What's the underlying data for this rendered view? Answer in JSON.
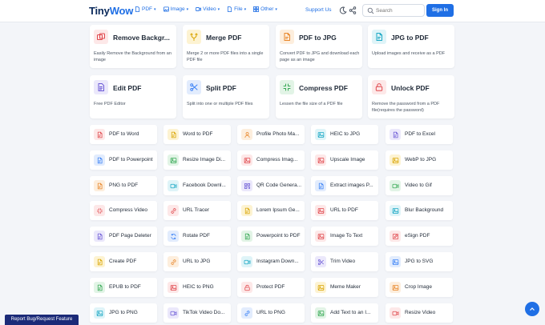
{
  "header": {
    "logo_a": "Tiny",
    "logo_b": "Wow",
    "nav": [
      {
        "label": "PDF",
        "icon": "pdf-icon"
      },
      {
        "label": "Image",
        "icon": "image-icon"
      },
      {
        "label": "Video",
        "icon": "video-icon"
      },
      {
        "label": "File",
        "icon": "file-icon"
      },
      {
        "label": "Other",
        "icon": "grid-icon"
      }
    ],
    "support": "Support Us",
    "search_placeholder": "Search",
    "signin": "Sign In"
  },
  "colors": {
    "brand": "#1f6fe5",
    "navy": "#0b2a5b",
    "report_bg": "#1b2a78"
  },
  "featured": [
    {
      "title": "Remove Backgr...",
      "desc": "Easily Remove the Background from an image",
      "icon": "remove-bg-icon",
      "color": "#e0474c",
      "bg": "#fde8e8"
    },
    {
      "title": "Merge PDF",
      "desc": "Merge 2 or more PDF files into a single PDF file",
      "icon": "merge-icon",
      "color": "#d9a400",
      "bg": "#fdf3d2"
    },
    {
      "title": "PDF to JPG",
      "desc": "Convert PDF to JPG and download each page as an image",
      "icon": "document-icon",
      "color": "#e8862a",
      "bg": "#fdeedd"
    },
    {
      "title": "JPG to PDF",
      "desc": "Upload images and receive as a PDF",
      "icon": "document-icon",
      "color": "#19a7c4",
      "bg": "#dff4f8"
    },
    {
      "title": "Edit PDF",
      "desc": "Free PDF Editor",
      "icon": "edit-doc-icon",
      "color": "#6c5ad6",
      "bg": "#ebe8fb"
    },
    {
      "title": "Split PDF",
      "desc": "Split into one or multiple PDF files",
      "icon": "scissors-icon",
      "color": "#3b82f6",
      "bg": "#e2ecfd"
    },
    {
      "title": "Compress PDF",
      "desc": "Lessen the file size of a PDF file",
      "icon": "compress-icon",
      "color": "#34a853",
      "bg": "#e2f4e6"
    },
    {
      "title": "Unlock PDF",
      "desc": "Remove the password from a PDF file(requires the password)",
      "icon": "lock-icon",
      "color": "#e0474c",
      "bg": "#fde8e8"
    }
  ],
  "tools": [
    [
      {
        "label": "PDF to Word",
        "icon": "pdf-word-icon",
        "color": "#e0474c",
        "bg": "#fde8e8"
      },
      {
        "label": "Word to PDF",
        "icon": "word-pdf-icon",
        "color": "#d9a400",
        "bg": "#fdf3d2"
      },
      {
        "label": "Profile Photo Ma...",
        "icon": "user-icon",
        "color": "#e8862a",
        "bg": "#fdeedd"
      },
      {
        "label": "HEIC to JPG",
        "icon": "image-icon",
        "color": "#19a7c4",
        "bg": "#dff4f8"
      },
      {
        "label": "PDF to Excel",
        "icon": "excel-icon",
        "color": "#6c5ad6",
        "bg": "#ebe8fb"
      }
    ],
    [
      {
        "label": "PDF to Powerpoint",
        "icon": "ppt-icon",
        "color": "#3b82f6",
        "bg": "#e2ecfd"
      },
      {
        "label": "Resize Image Di...",
        "icon": "image-icon",
        "color": "#34a853",
        "bg": "#e2f4e6"
      },
      {
        "label": "Compress Imag...",
        "icon": "image-icon",
        "color": "#e0474c",
        "bg": "#fde8e8"
      },
      {
        "label": "Upscale Image",
        "icon": "image-icon",
        "color": "#e0474c",
        "bg": "#fde8e8"
      },
      {
        "label": "WebP to JPG",
        "icon": "image-icon",
        "color": "#d9a400",
        "bg": "#fdf3d2"
      }
    ],
    [
      {
        "label": "PNG to PDF",
        "icon": "document-icon",
        "color": "#e8862a",
        "bg": "#fdeedd"
      },
      {
        "label": "Facebook Downl...",
        "icon": "video-icon",
        "color": "#19a7c4",
        "bg": "#dff4f8"
      },
      {
        "label": "QR Code Genera...",
        "icon": "qr-icon",
        "color": "#6c5ad6",
        "bg": "#ebe8fb"
      },
      {
        "label": "Extract images P...",
        "icon": "document-icon",
        "color": "#3b82f6",
        "bg": "#e2ecfd"
      },
      {
        "label": "Video to Gif",
        "icon": "video-icon",
        "color": "#34a853",
        "bg": "#e2f4e6"
      }
    ],
    [
      {
        "label": "Compress Video",
        "icon": "compress-icon",
        "color": "#e0474c",
        "bg": "#fde8e8"
      },
      {
        "label": "URL Tracer",
        "icon": "link-icon",
        "color": "#e0474c",
        "bg": "#fde8e8"
      },
      {
        "label": "Lorem Ipsum Ge...",
        "icon": "document-icon",
        "color": "#d9a400",
        "bg": "#fdf3d2"
      },
      {
        "label": "URL to PDF",
        "icon": "image-icon",
        "color": "#e0474c",
        "bg": "#fde8e8"
      },
      {
        "label": "Blur Background",
        "icon": "image-icon",
        "color": "#19a7c4",
        "bg": "#dff4f8"
      }
    ],
    [
      {
        "label": "PDF Page Deleter",
        "icon": "document-icon",
        "color": "#6c5ad6",
        "bg": "#ebe8fb"
      },
      {
        "label": "Rotate PDF",
        "icon": "rotate-icon",
        "color": "#3b82f6",
        "bg": "#e2ecfd"
      },
      {
        "label": "Powerpoint to PDF",
        "icon": "document-icon",
        "color": "#34a853",
        "bg": "#e2f4e6"
      },
      {
        "label": "Image To Text",
        "icon": "image-icon",
        "color": "#e0474c",
        "bg": "#fde8e8"
      },
      {
        "label": "eSign PDF",
        "icon": "pen-icon",
        "color": "#e0474c",
        "bg": "#fde8e8"
      }
    ],
    [
      {
        "label": "Create PDF",
        "icon": "document-icon",
        "color": "#d9a400",
        "bg": "#fdf3d2"
      },
      {
        "label": "URL to JPG",
        "icon": "link-icon",
        "color": "#e8862a",
        "bg": "#fdeedd"
      },
      {
        "label": "Instagram Down...",
        "icon": "video-icon",
        "color": "#19a7c4",
        "bg": "#dff4f8"
      },
      {
        "label": "Trim Video",
        "icon": "scissors-icon",
        "color": "#6c5ad6",
        "bg": "#ebe8fb"
      },
      {
        "label": "JPG to SVG",
        "icon": "image-icon",
        "color": "#3b82f6",
        "bg": "#e2ecfd"
      }
    ],
    [
      {
        "label": "EPUB to PDF",
        "icon": "document-icon",
        "color": "#34a853",
        "bg": "#e2f4e6"
      },
      {
        "label": "HEIC to PNG",
        "icon": "image-icon",
        "color": "#e0474c",
        "bg": "#fde8e8"
      },
      {
        "label": "Protect PDF",
        "icon": "lock-icon",
        "color": "#e0474c",
        "bg": "#fde8e8"
      },
      {
        "label": "Meme Maker",
        "icon": "image-icon",
        "color": "#d9a400",
        "bg": "#fdf3d2"
      },
      {
        "label": "Crop Image",
        "icon": "image-icon",
        "color": "#e8862a",
        "bg": "#fdeedd"
      }
    ],
    [
      {
        "label": "JPG to PNG",
        "icon": "image-icon",
        "color": "#19a7c4",
        "bg": "#dff4f8"
      },
      {
        "label": "TikTok Video Do...",
        "icon": "video-icon",
        "color": "#6c5ad6",
        "bg": "#ebe8fb"
      },
      {
        "label": "URL to PNG",
        "icon": "link-icon",
        "color": "#3b82f6",
        "bg": "#e2ecfd"
      },
      {
        "label": "Add Text to an I...",
        "icon": "image-icon",
        "color": "#34a853",
        "bg": "#e2f4e6"
      },
      {
        "label": "Resize Video",
        "icon": "video-icon",
        "color": "#e0474c",
        "bg": "#fde8e8"
      }
    ]
  ],
  "report": "Report Bug/Request Feature"
}
